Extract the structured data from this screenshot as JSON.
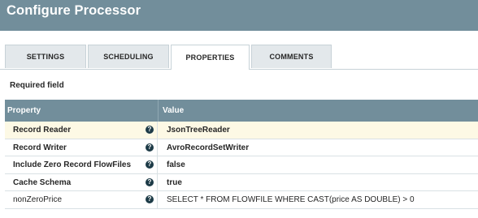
{
  "dialog": {
    "title": "Configure Processor"
  },
  "tabs": [
    {
      "label": "SETTINGS"
    },
    {
      "label": "SCHEDULING"
    },
    {
      "label": "PROPERTIES",
      "active": true
    },
    {
      "label": "COMMENTS"
    }
  ],
  "required_label": "Required field",
  "table": {
    "headers": {
      "property": "Property",
      "value": "Value"
    },
    "rows": [
      {
        "property": "Record Reader",
        "value": "JsonTreeReader",
        "required": true,
        "selected": true,
        "help_icon": "?"
      },
      {
        "property": "Record Writer",
        "value": "AvroRecordSetWriter",
        "required": true,
        "help_icon": "?"
      },
      {
        "property": "Include Zero Record FlowFiles",
        "value": "false",
        "required": true,
        "help_icon": "?"
      },
      {
        "property": "Cache Schema",
        "value": "true",
        "required": true,
        "help_icon": "?"
      },
      {
        "property": "nonZeroPrice",
        "value": "SELECT * FROM FLOWFILE WHERE CAST(price AS DOUBLE) > 0",
        "required": false,
        "help_icon": "?"
      }
    ]
  },
  "colors": {
    "header_bg": "#728e9b",
    "selected_row_bg": "#fdf9e5",
    "help_icon_bg": "#1d3b47"
  }
}
